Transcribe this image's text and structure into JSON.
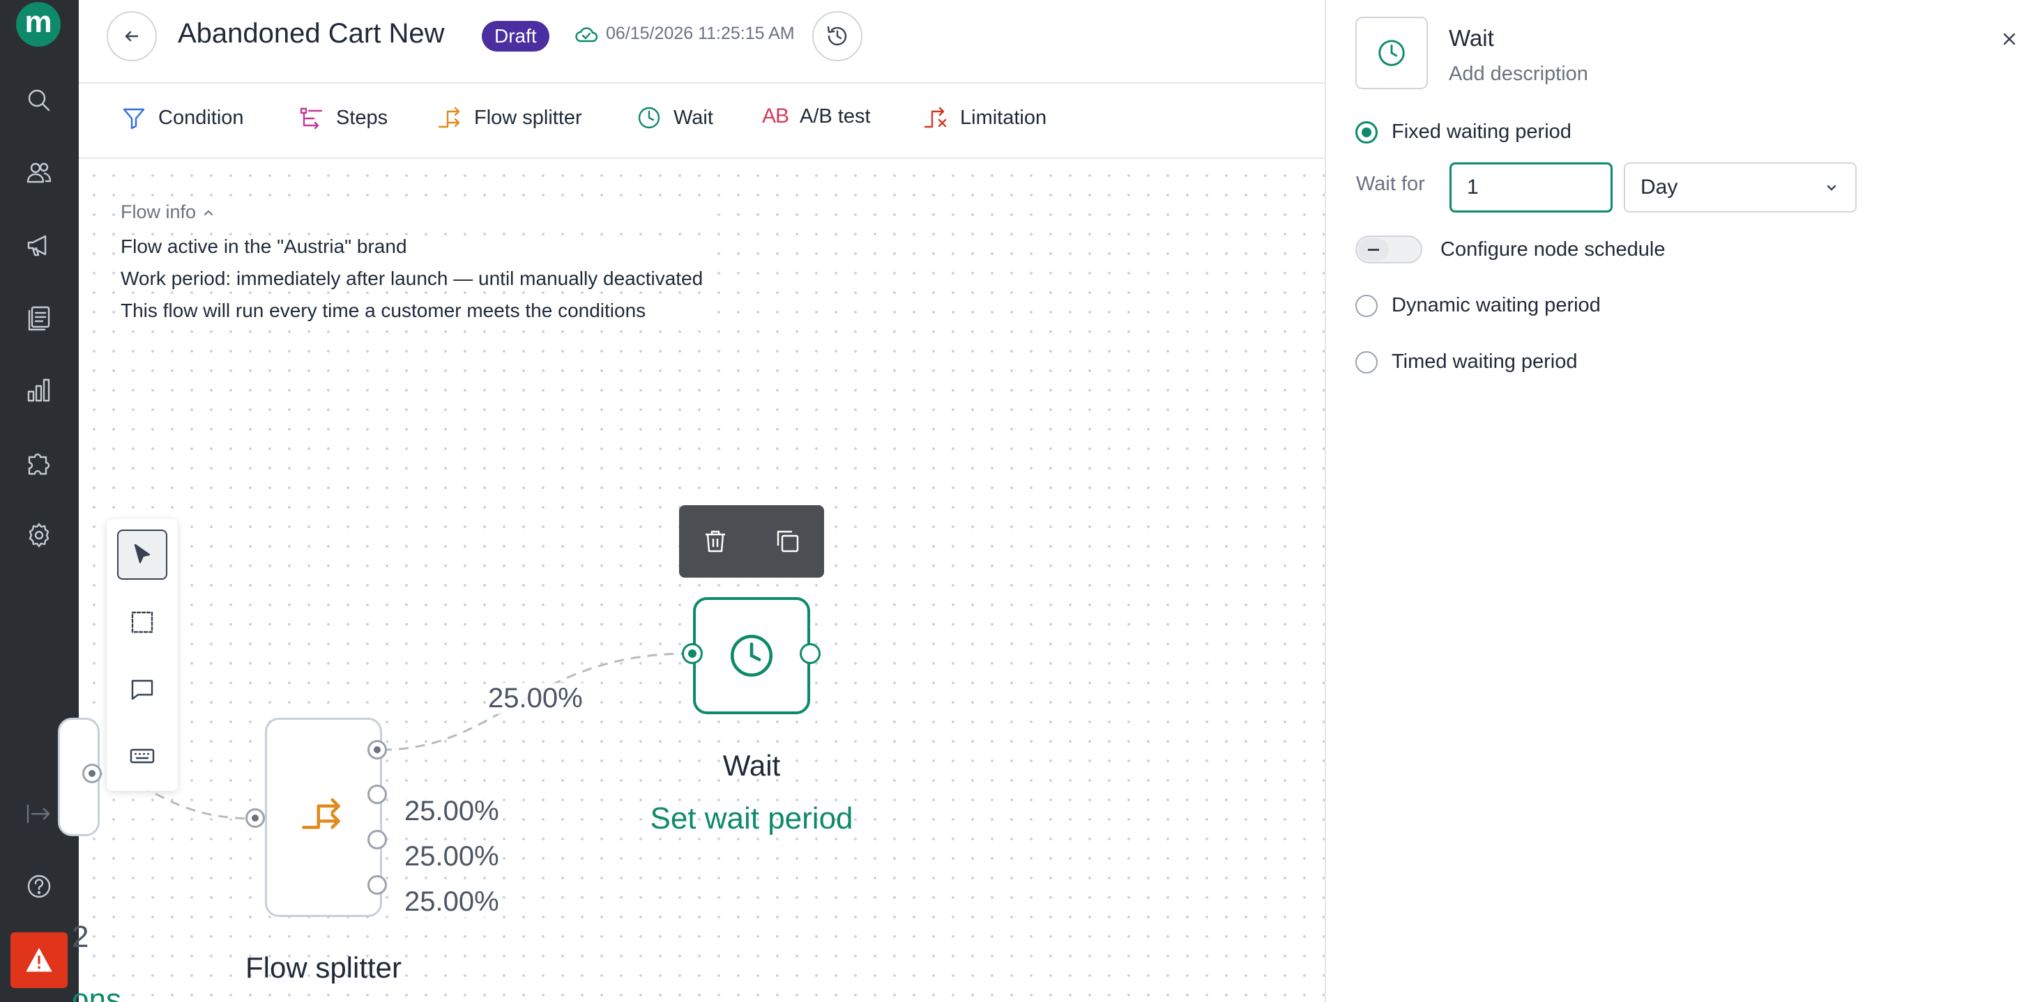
{
  "app": {
    "logo_letter": "m"
  },
  "nav": {
    "items": [
      "search-icon",
      "users-icon",
      "megaphone-icon",
      "documents-icon",
      "analytics-icon",
      "integrations-icon",
      "settings-icon",
      "collapse-icon",
      "help-icon",
      "alert-icon"
    ]
  },
  "header": {
    "title": "Abandoned Cart New",
    "badge": "Draft",
    "saved_at": "06/15/2026 11:25:15 AM"
  },
  "toolbar": {
    "items": [
      {
        "label": "Condition",
        "icon": "filter-icon",
        "color": "#2f6fdb"
      },
      {
        "label": "Steps",
        "icon": "steps-icon",
        "color": "#c2399a"
      },
      {
        "label": "Flow splitter",
        "icon": "splitter-icon",
        "color": "#e08a1e"
      },
      {
        "label": "Wait",
        "icon": "clock-icon",
        "color": "#0e8a6a"
      },
      {
        "label": "A/B test",
        "icon": "ab-icon",
        "color": "#d23c5a"
      },
      {
        "label": "Limitation",
        "icon": "limitation-icon",
        "color": "#d2391f"
      }
    ]
  },
  "flow_info": {
    "header": "Flow info",
    "lines": [
      "Flow active in the \"Austria\" brand",
      "Work period: immediately after launch — until manually deactivated",
      "This flow will run every time a customer meets the conditions"
    ]
  },
  "canvas": {
    "wait_node": {
      "label": "Wait",
      "subtitle": "Set wait period"
    },
    "splitter_node": {
      "label": "Flow splitter"
    },
    "percentages": [
      "25.00%",
      "25.00%",
      "25.00%",
      "25.00%"
    ],
    "cut_off_text": {
      "number": "2",
      "word": "ons"
    }
  },
  "panel": {
    "title": "Wait",
    "description_placeholder": "Add description",
    "options": {
      "fixed": "Fixed waiting period",
      "dynamic": "Dynamic waiting period",
      "timed": "Timed waiting period"
    },
    "selected_option": "fixed",
    "wait_for_label": "Wait for",
    "wait_value": "1",
    "wait_unit": "Day",
    "schedule_toggle_label": "Configure node schedule",
    "schedule_enabled": false
  },
  "colors": {
    "accent": "#0e8a6a",
    "draft": "#4b2e9f",
    "rail": "#2b2f33",
    "alert": "#e0351b"
  }
}
